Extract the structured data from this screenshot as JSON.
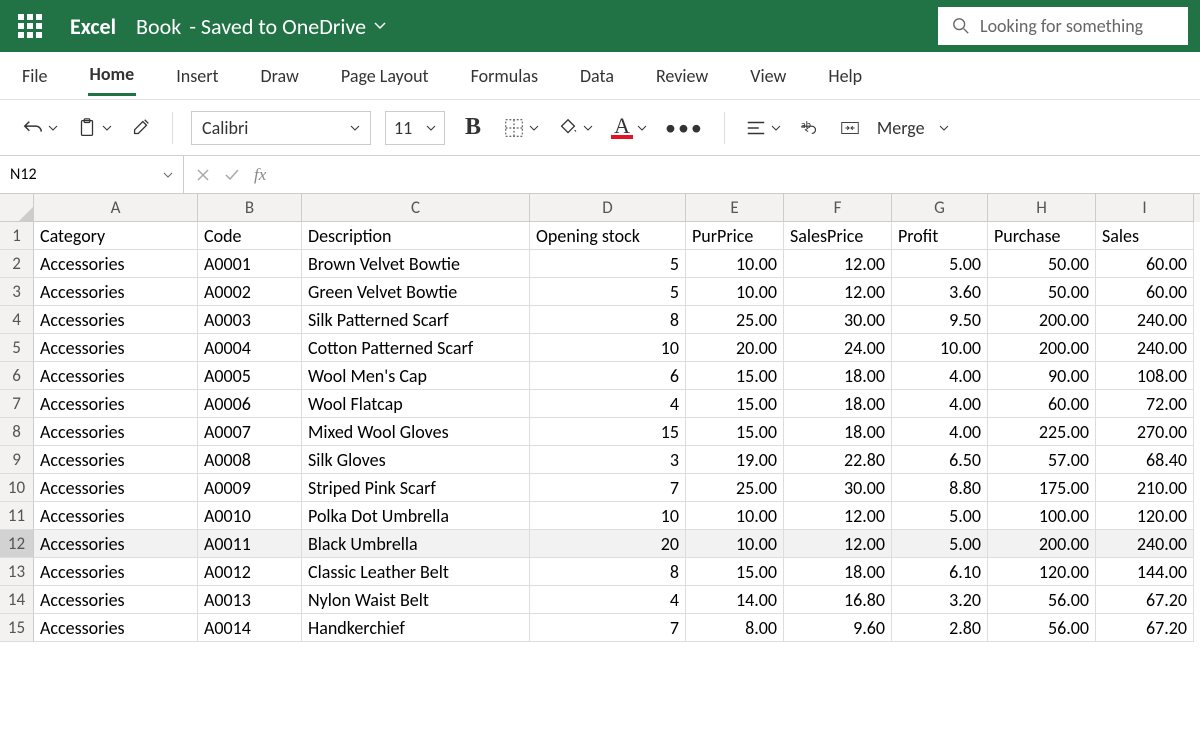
{
  "titlebar": {
    "app": "Excel",
    "doc": "Book",
    "saved": "- Saved to OneDrive",
    "search_placeholder": "Looking for something"
  },
  "ribbon": {
    "tabs": [
      "File",
      "Home",
      "Insert",
      "Draw",
      "Page Layout",
      "Formulas",
      "Data",
      "Review",
      "View",
      "Help"
    ],
    "active_tab": "Home",
    "font_name": "Calibri",
    "font_size": "11",
    "merge_label": "Merge"
  },
  "formula": {
    "name_box": "N12",
    "fx": "fx"
  },
  "columns": [
    "A",
    "B",
    "C",
    "D",
    "E",
    "F",
    "G",
    "H",
    "I"
  ],
  "headers": [
    "Category",
    "Code",
    "Description",
    "Opening stock",
    "PurPrice",
    "SalesPrice",
    "Profit",
    "Purchase",
    "Sales"
  ],
  "selected_row": 12,
  "rows": [
    {
      "n": 2,
      "v": [
        "Accessories",
        "A0001",
        "Brown Velvet Bowtie",
        "5",
        "10.00",
        "12.00",
        "5.00",
        "50.00",
        "60.00"
      ]
    },
    {
      "n": 3,
      "v": [
        "Accessories",
        "A0002",
        "Green Velvet Bowtie",
        "5",
        "10.00",
        "12.00",
        "3.60",
        "50.00",
        "60.00"
      ]
    },
    {
      "n": 4,
      "v": [
        "Accessories",
        "A0003",
        "Silk Patterned Scarf",
        "8",
        "25.00",
        "30.00",
        "9.50",
        "200.00",
        "240.00"
      ]
    },
    {
      "n": 5,
      "v": [
        "Accessories",
        "A0004",
        "Cotton Patterned Scarf",
        "10",
        "20.00",
        "24.00",
        "10.00",
        "200.00",
        "240.00"
      ]
    },
    {
      "n": 6,
      "v": [
        "Accessories",
        "A0005",
        "Wool Men's Cap",
        "6",
        "15.00",
        "18.00",
        "4.00",
        "90.00",
        "108.00"
      ]
    },
    {
      "n": 7,
      "v": [
        "Accessories",
        "A0006",
        "Wool Flatcap",
        "4",
        "15.00",
        "18.00",
        "4.00",
        "60.00",
        "72.00"
      ]
    },
    {
      "n": 8,
      "v": [
        "Accessories",
        "A0007",
        "Mixed Wool Gloves",
        "15",
        "15.00",
        "18.00",
        "4.00",
        "225.00",
        "270.00"
      ]
    },
    {
      "n": 9,
      "v": [
        "Accessories",
        "A0008",
        "Silk Gloves",
        "3",
        "19.00",
        "22.80",
        "6.50",
        "57.00",
        "68.40"
      ]
    },
    {
      "n": 10,
      "v": [
        "Accessories",
        "A0009",
        "Striped Pink Scarf",
        "7",
        "25.00",
        "30.00",
        "8.80",
        "175.00",
        "210.00"
      ]
    },
    {
      "n": 11,
      "v": [
        "Accessories",
        "A0010",
        "Polka Dot Umbrella",
        "10",
        "10.00",
        "12.00",
        "5.00",
        "100.00",
        "120.00"
      ]
    },
    {
      "n": 12,
      "v": [
        "Accessories",
        "A0011",
        "Black Umbrella",
        "20",
        "10.00",
        "12.00",
        "5.00",
        "200.00",
        "240.00"
      ]
    },
    {
      "n": 13,
      "v": [
        "Accessories",
        "A0012",
        "Classic Leather Belt",
        "8",
        "15.00",
        "18.00",
        "6.10",
        "120.00",
        "144.00"
      ]
    },
    {
      "n": 14,
      "v": [
        "Accessories",
        "A0013",
        "Nylon Waist Belt",
        "4",
        "14.00",
        "16.80",
        "3.20",
        "56.00",
        "67.20"
      ]
    },
    {
      "n": 15,
      "v": [
        "Accessories",
        "A0014",
        "Handkerchief",
        "7",
        "8.00",
        "9.60",
        "2.80",
        "56.00",
        "67.20"
      ]
    }
  ]
}
